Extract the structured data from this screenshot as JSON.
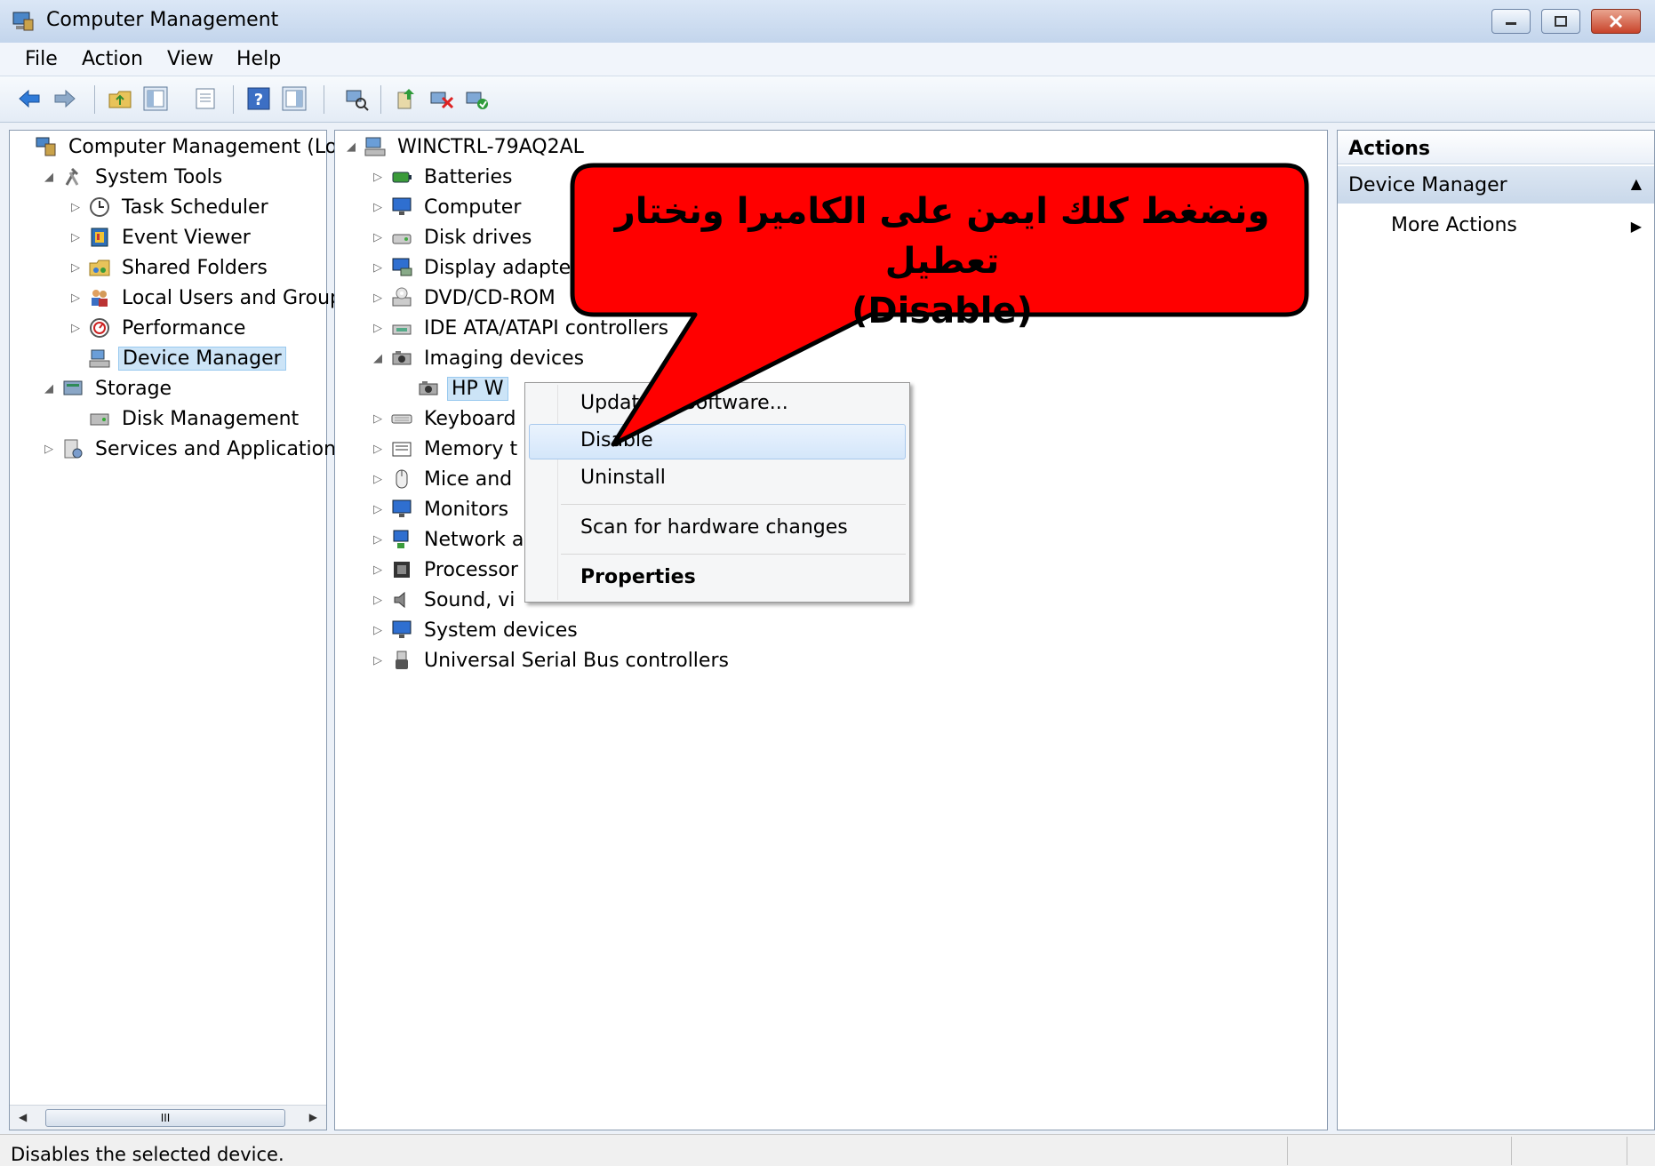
{
  "window": {
    "title": "Computer Management"
  },
  "menu": [
    "File",
    "Action",
    "View",
    "Help"
  ],
  "toolbar_icons": [
    "back-arrow-icon",
    "forward-arrow-icon",
    "up-folder-icon",
    "show-hide-tree-icon",
    "properties-icon",
    "help-icon",
    "show-hide-action-pane-icon",
    "scan-hardware-icon",
    "update-driver-icon",
    "disable-device-icon",
    "enable-device-icon"
  ],
  "left_tree": [
    {
      "label": "Computer Management (Local",
      "level": 0,
      "exp": "",
      "icon": "computer-management-icon"
    },
    {
      "label": "System Tools",
      "level": 1,
      "exp": "◢",
      "icon": "system-tools-icon"
    },
    {
      "label": "Task Scheduler",
      "level": 2,
      "exp": "▷",
      "icon": "clock-icon"
    },
    {
      "label": "Event Viewer",
      "level": 2,
      "exp": "▷",
      "icon": "event-viewer-icon"
    },
    {
      "label": "Shared Folders",
      "level": 2,
      "exp": "▷",
      "icon": "shared-folder-icon"
    },
    {
      "label": "Local Users and Groups",
      "level": 2,
      "exp": "▷",
      "icon": "users-icon"
    },
    {
      "label": "Performance",
      "level": 2,
      "exp": "▷",
      "icon": "performance-icon"
    },
    {
      "label": "Device Manager",
      "level": 2,
      "exp": "",
      "icon": "device-manager-icon",
      "selected": true
    },
    {
      "label": "Storage",
      "level": 1,
      "exp": "◢",
      "icon": "storage-icon"
    },
    {
      "label": "Disk Management",
      "level": 2,
      "exp": "",
      "icon": "disk-management-icon"
    },
    {
      "label": "Services and Applications",
      "level": 1,
      "exp": "▷",
      "icon": "services-icon"
    }
  ],
  "device_tree": [
    {
      "label": "WINCTRL-79AQ2AL",
      "level": 0,
      "exp": "◢",
      "icon": "computer-icon"
    },
    {
      "label": "Batteries",
      "level": 1,
      "exp": "▷",
      "icon": "battery-icon"
    },
    {
      "label": "Computer",
      "level": 1,
      "exp": "▷",
      "icon": "monitor-icon"
    },
    {
      "label": "Disk drives",
      "level": 1,
      "exp": "▷",
      "icon": "disk-drive-icon"
    },
    {
      "label": "Display adapte",
      "level": 1,
      "exp": "▷",
      "icon": "display-adapter-icon"
    },
    {
      "label": "DVD/CD-ROM",
      "level": 1,
      "exp": "▷",
      "icon": "dvd-icon"
    },
    {
      "label": "IDE ATA/ATAPI controllers",
      "level": 1,
      "exp": "▷",
      "icon": "ide-controller-icon"
    },
    {
      "label": "Imaging devices",
      "level": 1,
      "exp": "◢",
      "icon": "imaging-device-icon"
    },
    {
      "label": "HP W",
      "level": 2,
      "exp": "",
      "icon": "webcam-icon",
      "selected": true
    },
    {
      "label": "Keyboard",
      "level": 1,
      "exp": "▷",
      "icon": "keyboard-icon"
    },
    {
      "label": "Memory t",
      "level": 1,
      "exp": "▷",
      "icon": "memory-icon"
    },
    {
      "label": "Mice and",
      "level": 1,
      "exp": "▷",
      "icon": "mouse-icon"
    },
    {
      "label": "Monitors",
      "level": 1,
      "exp": "▷",
      "icon": "monitor-icon"
    },
    {
      "label": "Network a",
      "level": 1,
      "exp": "▷",
      "icon": "network-icon"
    },
    {
      "label": "Processor",
      "level": 1,
      "exp": "▷",
      "icon": "processor-icon"
    },
    {
      "label": "Sound, vi",
      "level": 1,
      "exp": "▷",
      "icon": "speaker-icon"
    },
    {
      "label": "System devices",
      "level": 1,
      "exp": "▷",
      "icon": "system-devices-icon"
    },
    {
      "label": "Universal Serial Bus controllers",
      "level": 1,
      "exp": "▷",
      "icon": "usb-icon"
    }
  ],
  "actions": {
    "header": "Actions",
    "section": "Device Manager",
    "more": "More Actions"
  },
  "context_menu": [
    {
      "label": "Updat     ver Software...",
      "bold": false
    },
    {
      "label": "Disable",
      "bold": false,
      "highlighted": true
    },
    {
      "label": "Uninstall",
      "bold": false
    },
    {
      "label": "Scan for hardware changes",
      "bold": false
    },
    {
      "label": "Properties",
      "bold": true
    }
  ],
  "callout": {
    "line1": "ونضغط كلك ايمن على الكاميرا ونختار تعطيل",
    "line2": "(Disable)",
    "fill": "#ff0000"
  },
  "status": {
    "text": "Disables the selected device."
  },
  "scrollbar": {
    "thumb_label": "III"
  },
  "colors": {
    "selection": "#cce4f7",
    "titlebar": "#c3d5ec",
    "callout_fill": "#ff0000"
  }
}
